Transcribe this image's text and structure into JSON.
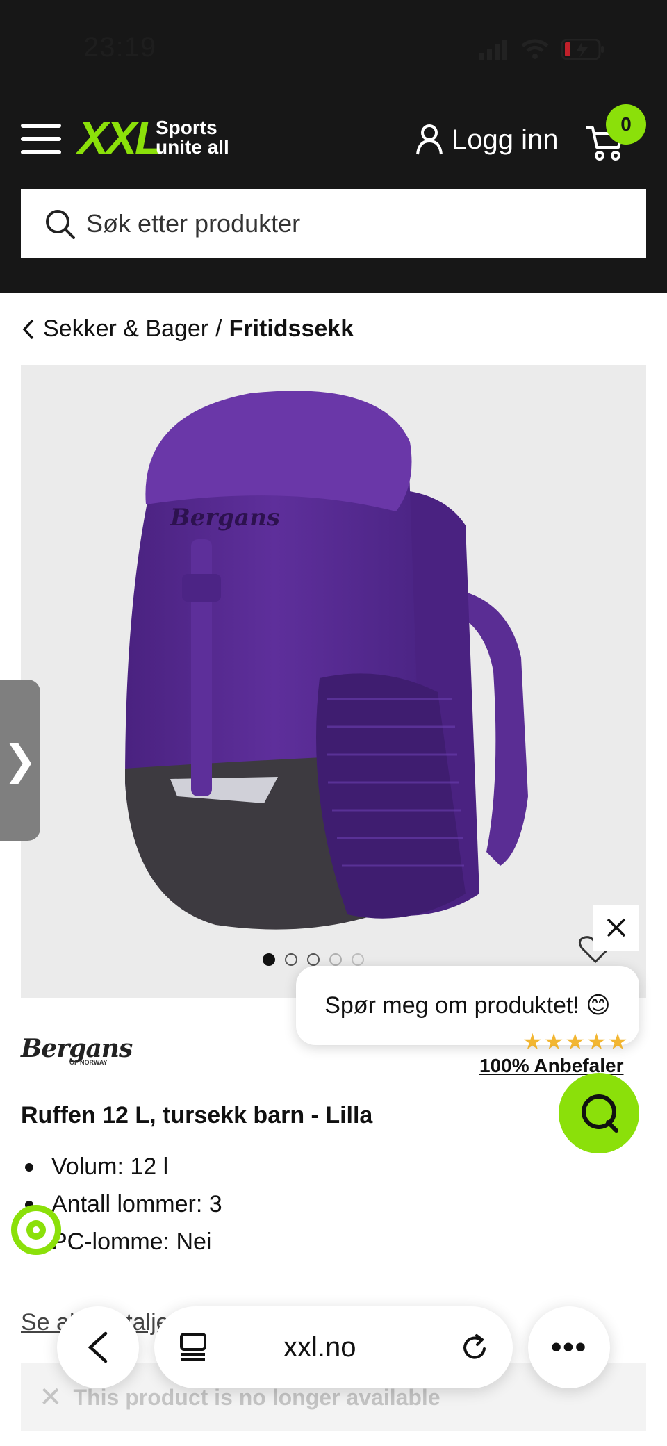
{
  "status_bar": {
    "time": "23:19"
  },
  "header": {
    "logo": "XXL",
    "tagline_line1": "Sports",
    "tagline_line2": "unite all",
    "login_label": "Logg inn",
    "cart_count": "0",
    "search_placeholder": "Søk etter produkter"
  },
  "breadcrumb": {
    "parent": "Sekker & Bager",
    "separator": "/",
    "current": "Fritidssekk"
  },
  "product": {
    "brand": "Bergans",
    "brand_sub": "OF NORWAY",
    "recommend": "100% Anbefaler",
    "title": "Ruffen 12 L, tursekk barn - Lilla",
    "features": [
      "Volum: 12 l",
      "Antall lommer: 3",
      "PC-lomme: Nei"
    ],
    "see_all_label": "Se alle detaljer",
    "unavailable_text": "This product is no longer available",
    "image_dots": 5,
    "active_dot": 0
  },
  "chat": {
    "prompt": "Spør meg om produktet! 😊"
  },
  "browser": {
    "url": "xxl.no"
  },
  "colors": {
    "brand_green": "#8be00a",
    "header_bg": "#171717",
    "bag_purple": "#5b2d96"
  },
  "icons": [
    "hamburger-icon",
    "person-icon",
    "cart-icon",
    "search-icon",
    "chevron-left-icon",
    "close-icon",
    "heart-icon",
    "chat-icon",
    "eco-icon",
    "back-icon",
    "tabs-icon",
    "reload-icon",
    "more-icon"
  ]
}
